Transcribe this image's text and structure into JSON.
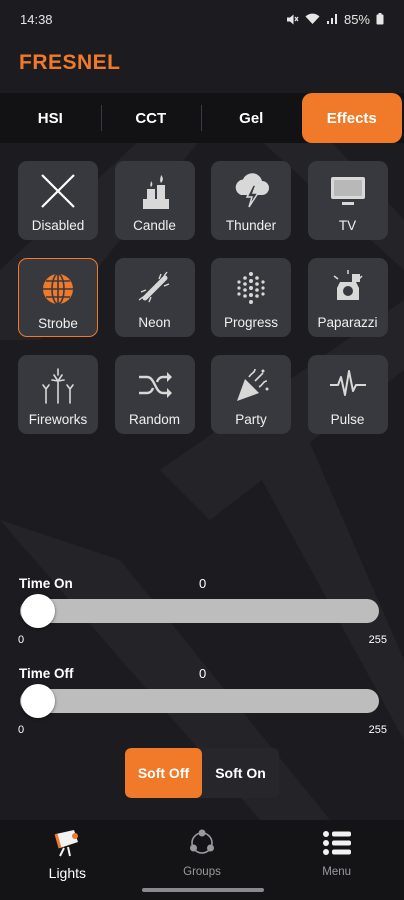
{
  "status_bar": {
    "time": "14:38",
    "battery": "85%",
    "icons": [
      "mute-icon",
      "wifi-icon",
      "signal-icon",
      "battery-icon"
    ]
  },
  "app": {
    "title": "FRESNEL"
  },
  "tabs": [
    {
      "label": "HSI",
      "active": false
    },
    {
      "label": "CCT",
      "active": false
    },
    {
      "label": "Gel",
      "active": false
    },
    {
      "label": "Effects",
      "active": true
    }
  ],
  "effects": [
    {
      "label": "Disabled",
      "icon": "x-icon",
      "selected": false
    },
    {
      "label": "Candle",
      "icon": "candle-icon",
      "selected": false
    },
    {
      "label": "Thunder",
      "icon": "thunder-icon",
      "selected": false
    },
    {
      "label": "TV",
      "icon": "tv-icon",
      "selected": false
    },
    {
      "label": "Strobe",
      "icon": "strobe-icon",
      "selected": true
    },
    {
      "label": "Neon",
      "icon": "neon-icon",
      "selected": false
    },
    {
      "label": "Progress",
      "icon": "progress-icon",
      "selected": false
    },
    {
      "label": "Paparazzi",
      "icon": "paparazzi-icon",
      "selected": false
    },
    {
      "label": "Fireworks",
      "icon": "fireworks-icon",
      "selected": false
    },
    {
      "label": "Random",
      "icon": "shuffle-icon",
      "selected": false
    },
    {
      "label": "Party",
      "icon": "party-popper-icon",
      "selected": false
    },
    {
      "label": "Pulse",
      "icon": "pulse-icon",
      "selected": false
    }
  ],
  "time_on": {
    "label": "Time On",
    "value": "0",
    "min": "0",
    "max": "255",
    "level": 0
  },
  "time_off": {
    "label": "Time Off",
    "value": "0",
    "min": "0",
    "max": "255",
    "level": 0
  },
  "soft_toggle": [
    {
      "label": "Soft Off",
      "active": true
    },
    {
      "label": "Soft On",
      "active": false
    }
  ],
  "bottom_nav": [
    {
      "label": "Lights",
      "icon": "spotlight-icon",
      "active": true
    },
    {
      "label": "Groups",
      "icon": "groups-icon",
      "active": false
    },
    {
      "label": "Menu",
      "icon": "menu-list-icon",
      "active": false
    }
  ],
  "colors": {
    "accent": "#f07a2a",
    "background": "#1c1c20",
    "tile": "#38393e"
  }
}
